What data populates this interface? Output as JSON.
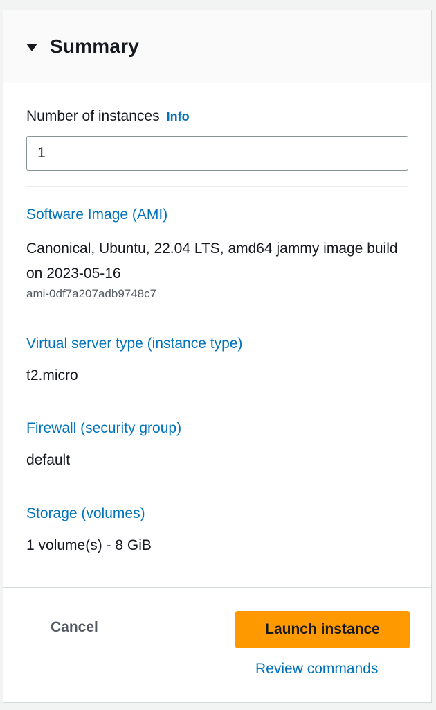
{
  "summary": {
    "title": "Summary",
    "caret_icon": "caret-down-icon"
  },
  "instances": {
    "label": "Number of instances",
    "info_label": "Info",
    "value": "1"
  },
  "ami": {
    "heading": "Software Image (AMI)",
    "description": "Canonical, Ubuntu, 22.04 LTS, amd64 jammy image build on 2023-05-16",
    "id": "ami-0df7a207adb9748c7"
  },
  "instance_type": {
    "heading": "Virtual server type (instance type)",
    "value": "t2.micro"
  },
  "firewall": {
    "heading": "Firewall (security group)",
    "value": "default"
  },
  "storage": {
    "heading": "Storage (volumes)",
    "value": "1 volume(s) - 8 GiB"
  },
  "actions": {
    "cancel_label": "Cancel",
    "launch_label": "Launch instance",
    "review_label": "Review commands"
  },
  "colors": {
    "link": "#0073bb",
    "primary_button": "#ff9900",
    "text": "#16191f"
  }
}
